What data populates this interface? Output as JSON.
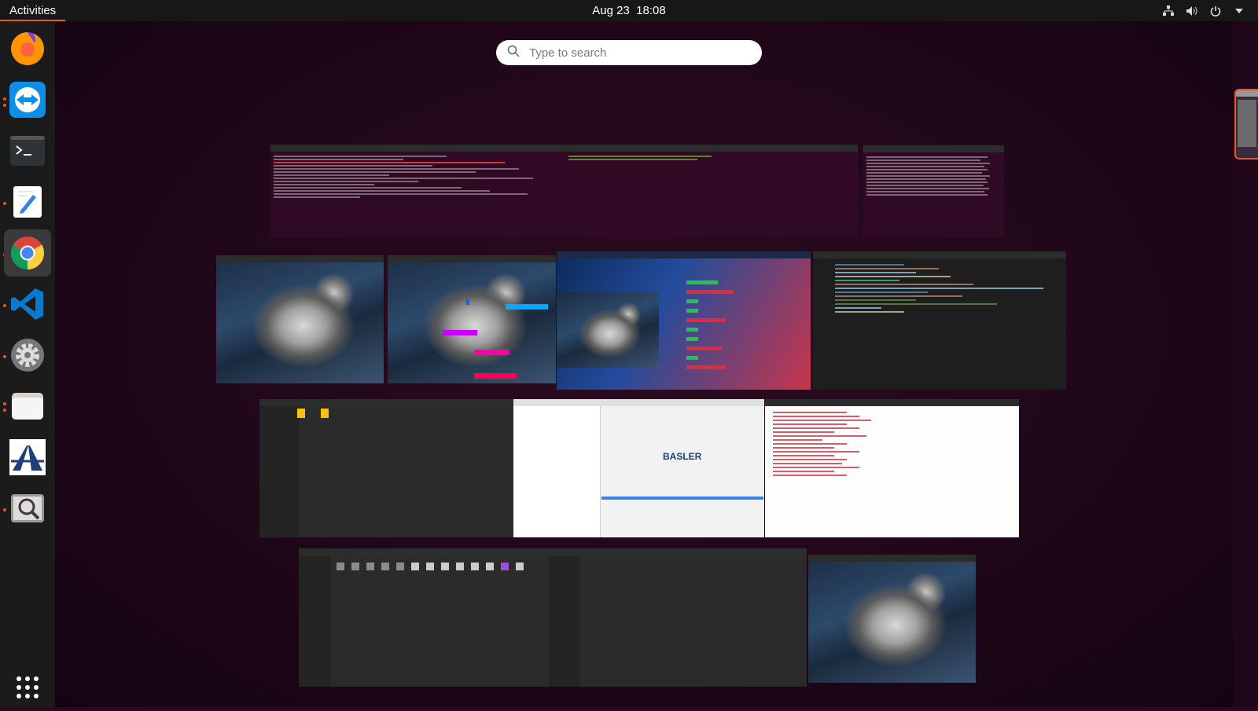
{
  "topbar": {
    "activities_label": "Activities",
    "date": "Aug 23",
    "time": "18:08"
  },
  "tray": {
    "icons": [
      "network-icon",
      "volume-icon",
      "power-icon",
      "chevron-down-icon"
    ]
  },
  "search": {
    "placeholder": "Type to search",
    "value": ""
  },
  "dock": {
    "items": [
      {
        "name": "firefox",
        "running": false
      },
      {
        "name": "teamviewer",
        "running": false
      },
      {
        "name": "terminal",
        "running": true
      },
      {
        "name": "text-editor",
        "running": true
      },
      {
        "name": "chrome",
        "running": true,
        "active": true
      },
      {
        "name": "vscode",
        "running": true
      },
      {
        "name": "settings",
        "running": true
      },
      {
        "name": "files",
        "running": true
      },
      {
        "name": "app-road-logo",
        "running": false
      },
      {
        "name": "image-viewer",
        "running": true
      }
    ],
    "show_apps": "show-applications-icon"
  },
  "windows": {
    "basler_logo_text": "BASLER"
  },
  "colors": {
    "accent": "#e95420",
    "background": "#2a0a1e",
    "topbar": "#171717",
    "dock": "#1b1b1b"
  }
}
